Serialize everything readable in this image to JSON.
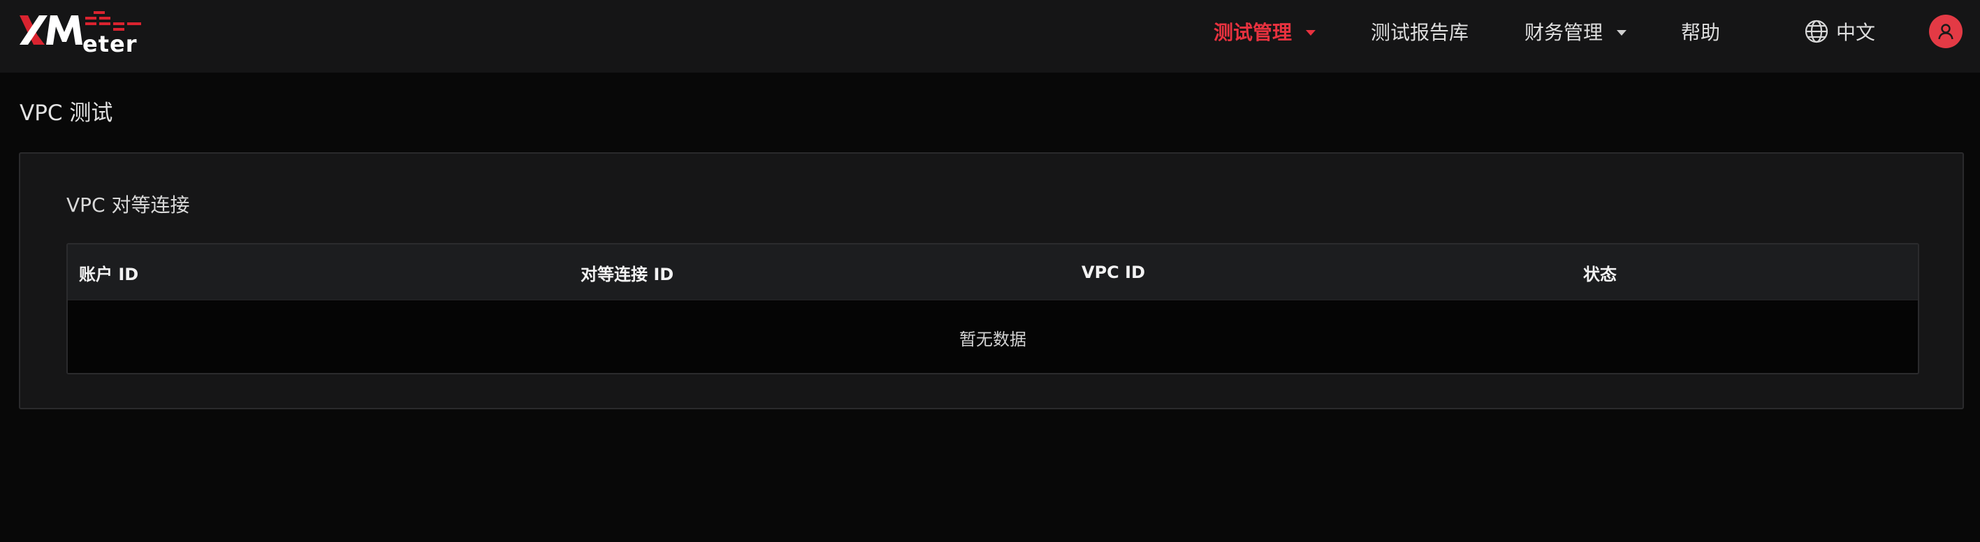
{
  "brand": {
    "logo_text": "XMeter",
    "colors": {
      "accent": "#e8323f",
      "logo_red": "#d9232f",
      "logo_white": "#ffffff"
    }
  },
  "nav": {
    "items": [
      {
        "label": "测试管理",
        "active": true,
        "has_dropdown": true
      },
      {
        "label": "测试报告库",
        "active": false,
        "has_dropdown": false
      },
      {
        "label": "财务管理",
        "active": false,
        "has_dropdown": true
      },
      {
        "label": "帮助",
        "active": false,
        "has_dropdown": false
      }
    ],
    "language": {
      "icon": "globe-icon",
      "label": "中文"
    },
    "avatar_icon": "user-icon"
  },
  "page": {
    "title": "VPC 测试"
  },
  "panel": {
    "title": "VPC 对等连接",
    "table": {
      "columns": [
        "账户 ID",
        "对等连接 ID",
        "VPC ID",
        "状态"
      ],
      "rows": [],
      "empty_text": "暂无数据"
    }
  }
}
